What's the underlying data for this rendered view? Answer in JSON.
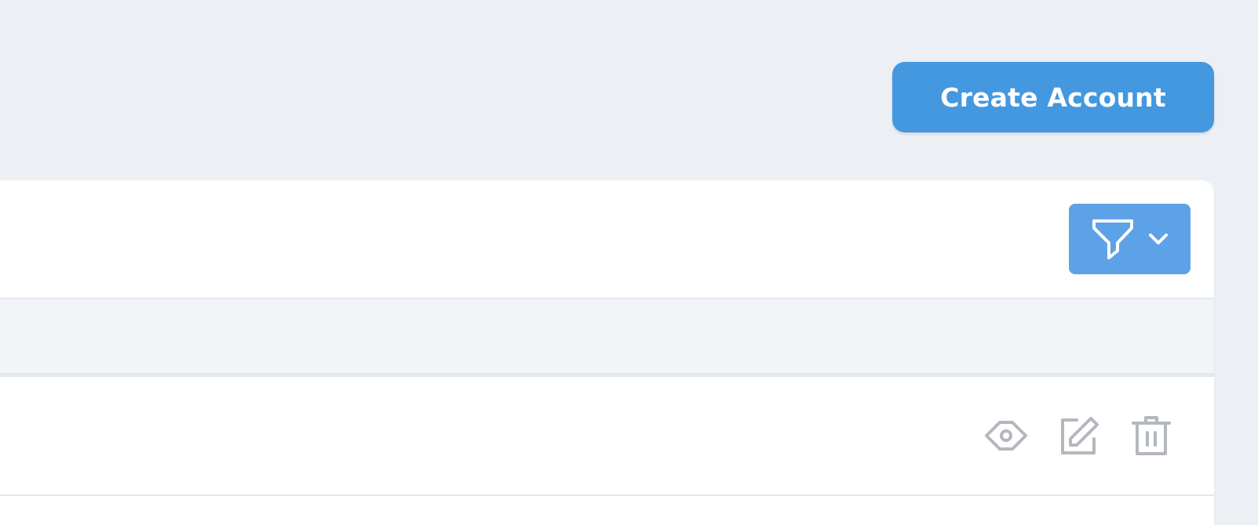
{
  "header": {
    "create_button_label": "Create Account"
  },
  "toolbar": {
    "filter_icon": "funnel-icon",
    "dropdown_icon": "chevron-down-icon"
  },
  "table": {
    "columns": [],
    "rows": [
      {
        "actions": [
          "eye-icon",
          "edit-icon",
          "trash-icon"
        ]
      }
    ]
  },
  "colors": {
    "primary": "#4398e0",
    "filter_button": "#5da2e6",
    "page_background": "#eceff3",
    "table_header_background": "#f1f5f8",
    "action_icon": "#b4b8be"
  }
}
